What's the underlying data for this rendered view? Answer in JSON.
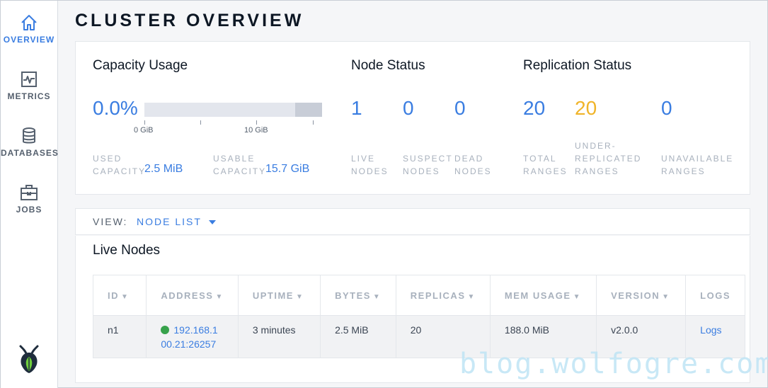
{
  "sidebar": {
    "items": [
      {
        "label": "OVERVIEW",
        "icon": "home-icon",
        "active": true
      },
      {
        "label": "METRICS",
        "icon": "metrics-icon",
        "active": false
      },
      {
        "label": "DATABASES",
        "icon": "database-icon",
        "active": false
      },
      {
        "label": "JOBS",
        "icon": "briefcase-icon",
        "active": false
      }
    ],
    "logo": "cockroachdb-logo"
  },
  "page": {
    "title": "CLUSTER OVERVIEW"
  },
  "capacity": {
    "title": "Capacity Usage",
    "percent": "0.0%",
    "bar_used_fraction": 0.0,
    "axis_ticks": [
      "0 GiB",
      "10 GiB"
    ],
    "used_label": "USED CAPACITY",
    "used_value": "2.5 MiB",
    "usable_label": "USABLE CAPACITY",
    "usable_value": "15.7 GiB"
  },
  "node_status": {
    "title": "Node Status",
    "items": [
      {
        "value": "1",
        "label": "LIVE NODES"
      },
      {
        "value": "0",
        "label": "SUSPECT NODES"
      },
      {
        "value": "0",
        "label": "DEAD NODES"
      }
    ]
  },
  "replication": {
    "title": "Replication Status",
    "items": [
      {
        "value": "20",
        "label": "TOTAL RANGES"
      },
      {
        "value": "20",
        "label": "UNDER-REPLICATED RANGES"
      },
      {
        "value": "0",
        "label": "UNAVAILABLE RANGES"
      }
    ]
  },
  "view": {
    "label": "VIEW:",
    "selected": "NODE LIST"
  },
  "nodes": {
    "title": "Live Nodes",
    "columns": [
      "ID",
      "ADDRESS",
      "UPTIME",
      "BYTES",
      "REPLICAS",
      "MEM USAGE",
      "VERSION",
      "LOGS"
    ],
    "rows": [
      {
        "id": "n1",
        "address_line1": "192.168.1",
        "address_line2": "00.21:26257",
        "uptime": "3 minutes",
        "bytes": "2.5 MiB",
        "replicas": "20",
        "mem_usage": "188.0 MiB",
        "version": "v2.0.0",
        "logs": "Logs"
      }
    ]
  },
  "colors": {
    "accent": "#3a7de1",
    "warning": "#f0b429",
    "live": "#37a24b"
  },
  "watermark": "blog.wolfogre.com"
}
